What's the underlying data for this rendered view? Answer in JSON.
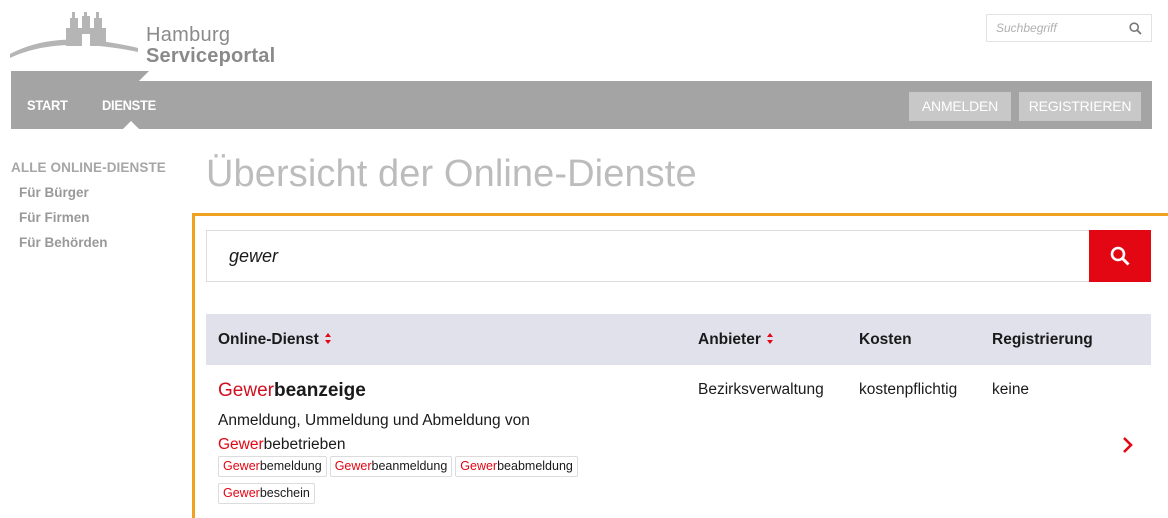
{
  "header": {
    "logo_line1": "Hamburg",
    "logo_line2": "Serviceportal",
    "search_placeholder": "Suchbegriff"
  },
  "nav": {
    "start": "START",
    "dienste": "DIENSTE",
    "login": "ANMELDEN",
    "register": "REGISTRIEREN"
  },
  "sidebar": {
    "heading": "ALLE ONLINE-DIENSTE",
    "items": [
      {
        "label": "Für Bürger"
      },
      {
        "label": "Für Firmen"
      },
      {
        "label": "Für Behörden"
      }
    ]
  },
  "main": {
    "title": "Übersicht der Online-Dienste",
    "search_value": "gewer",
    "columns": {
      "dienst": "Online-Dienst",
      "anbieter": "Anbieter",
      "kosten": "Kosten",
      "registrierung": "Registrierung"
    },
    "results": [
      {
        "title_highlight": "Gewer",
        "title_rest": "beanzeige",
        "desc_line1": "Anmeldung, Ummeldung und Abmeldung von",
        "desc_highlight": "Gewer",
        "desc_rest": "bebetrieben",
        "anbieter": "Bezirksverwaltung",
        "kosten": "kostenpflichtig",
        "registrierung": "keine",
        "tags": [
          {
            "hl": "Gewer",
            "rest": "bemeldung"
          },
          {
            "hl": "Gewer",
            "rest": "beanmeldung"
          },
          {
            "hl": "Gewer",
            "rest": "beabmeldung"
          },
          {
            "hl": "Gewer",
            "rest": "beschein"
          }
        ]
      }
    ]
  },
  "colors": {
    "accent_red": "#e30613",
    "orange_border": "#f0a11f",
    "nav_gray": "#a4a4a4",
    "table_header_bg": "#e1e1ec"
  }
}
